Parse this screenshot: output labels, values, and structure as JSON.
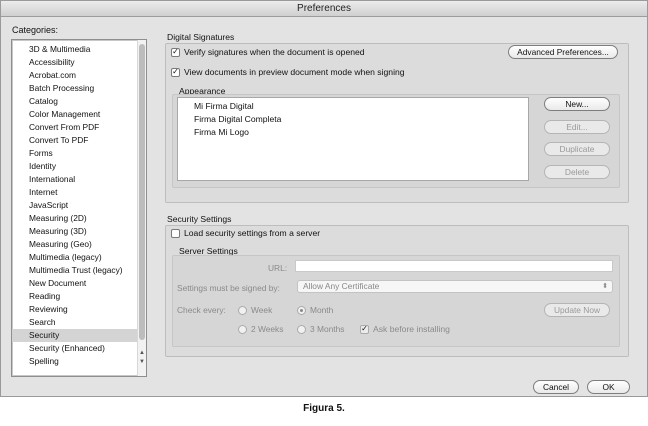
{
  "window": {
    "title": "Preferences"
  },
  "categories": {
    "label": "Categories:",
    "items": [
      "3D & Multimedia",
      "Accessibility",
      "Acrobat.com",
      "Batch Processing",
      "Catalog",
      "Color Management",
      "Convert From PDF",
      "Convert To PDF",
      "Forms",
      "Identity",
      "International",
      "Internet",
      "JavaScript",
      "Measuring (2D)",
      "Measuring (3D)",
      "Measuring (Geo)",
      "Multimedia (legacy)",
      "Multimedia Trust (legacy)",
      "New Document",
      "Reading",
      "Reviewing",
      "Search",
      "Security",
      "Security (Enhanced)",
      "Spelling"
    ],
    "selected": "Security"
  },
  "digital_signatures": {
    "title": "Digital Signatures",
    "verify_label": "Verify signatures when the document is opened",
    "verify_checked": true,
    "preview_label": "View documents in preview document mode when signing",
    "preview_checked": true,
    "advanced_button": "Advanced Preferences...",
    "appearance": {
      "title": "Appearance",
      "items": [
        "Mi Firma Digital",
        "Firma Digital Completa",
        "Firma Mi Logo"
      ],
      "new_button": "New...",
      "edit_button": "Edit...",
      "duplicate_button": "Duplicate",
      "delete_button": "Delete"
    }
  },
  "security_settings": {
    "title": "Security Settings",
    "load_label": "Load security settings from a server",
    "load_checked": false,
    "server": {
      "title": "Server Settings",
      "url_label": "URL:",
      "url_value": "",
      "signed_by_label": "Settings must be signed by:",
      "signed_by_value": "Allow Any Certificate",
      "check_every_label": "Check every:",
      "options": [
        "Week",
        "Month",
        "2 Weeks",
        "3 Months"
      ],
      "selected_option": "Month",
      "ask_label": "Ask before installing",
      "ask_checked": true,
      "update_button": "Update Now"
    }
  },
  "footer": {
    "cancel_button": "Cancel",
    "ok_button": "OK"
  },
  "caption": "Figura 5."
}
